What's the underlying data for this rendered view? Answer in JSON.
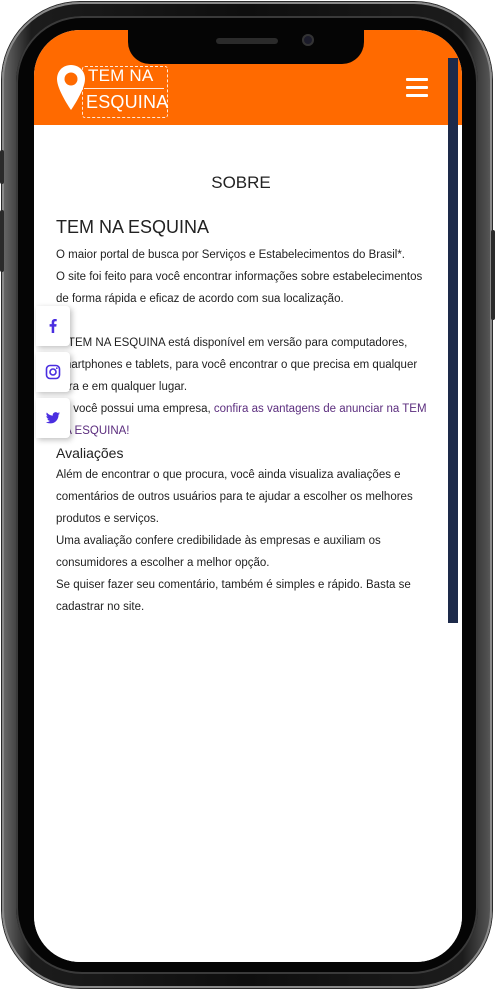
{
  "brand": {
    "logo_line1": "TEM NA",
    "logo_line2": "ESQUINA",
    "accent_color": "#ff6a00",
    "link_color": "#5b2d7e"
  },
  "header": {
    "menu_icon": "hamburger-icon"
  },
  "page": {
    "section_title": "SOBRE",
    "heading": "TEM NA ESQUINA",
    "p1": "O maior portal de busca por Serviços e Estabelecimentos do Brasil*.",
    "p2": "O site foi feito para você encontrar informações sobre estabelecimentos de forma rápida e eficaz de acordo com sua localização.",
    "p3": "O TEM NA ESQUINA está disponível em versão para computadores, smartphones e tablets, para você encontrar o que precisa em qualquer hora e em qualquer lugar.",
    "p4_prefix": "Se você possui uma empresa, ",
    "p4_link": "confira as vantagens de anunciar na TEM NA ESQUINA!",
    "subheading": "Avaliações",
    "p5": "Além de encontrar o que procura, você ainda visualiza avaliações e comentários de outros usuários para te ajudar a escolher os melhores produtos e serviços.",
    "p6": "Uma avaliação confere credibilidade às empresas e auxiliam os consumidores a escolher a melhor opção.",
    "p7": "Se quiser fazer seu comentário, também é simples e rápido. Basta se cadastrar no site."
  },
  "social": {
    "items": [
      "facebook-icon",
      "instagram-icon",
      "twitter-icon"
    ],
    "color": "#4a2ee0"
  }
}
